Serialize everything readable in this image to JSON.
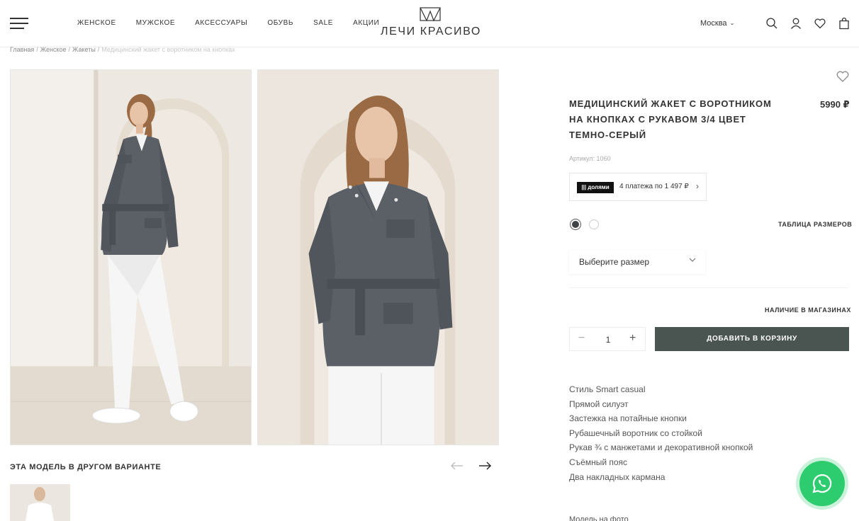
{
  "header": {
    "nav": [
      "ЖЕНСКОЕ",
      "МУЖСКОЕ",
      "АКСЕССУАРЫ",
      "ОБУВЬ",
      "SALE",
      "АКЦИИ"
    ],
    "logo_text": "ЛЕЧИ КРАСИВО",
    "city": "Москва",
    "icons": [
      "search-icon",
      "user-icon",
      "heart-icon",
      "bag-icon"
    ]
  },
  "breadcrumb": {
    "items": [
      "Главная",
      "Женское",
      "Жакеты"
    ],
    "current": "Медицинский жакет с воротником на кнопках"
  },
  "product": {
    "title": "МЕДИЦИНСКИЙ ЖАКЕТ С ВОРОТНИКОМ НА КНОПКАХ С РУКАВОМ 3/4 ЦВЕТ ТЕМНО-СЕРЫЙ",
    "price": "5990 ₽",
    "sku": "Артикул: 1060",
    "installment": {
      "badge": "||| долями",
      "text": "4 платежа по 1 497 ₽"
    },
    "colors": [
      "#3f4447",
      "#ffffff"
    ],
    "size_table": "ТАБЛИЦА РАЗМЕРОВ",
    "size_placeholder": "Выберите размер",
    "stores": "НАЛИЧИЕ В МАГАЗИНАХ",
    "quantity": "1",
    "add_to_cart": "ДОБАВИТЬ В КОРЗИНУ",
    "features": [
      "Стиль Smart casual",
      "Прямой силуэт",
      "Застежка на потайные кнопки",
      "Рубашечный воротник со стойкой",
      "Рукав ¾ с манжетами и декоративной кнопкой",
      "Съёмный пояс",
      "Два накладных кармана"
    ],
    "model_label": "Модель на фото"
  },
  "variants": {
    "title": "ЭТА МОДЕЛЬ В ДРУГОМ ВАРИАНТЕ"
  },
  "colors": {
    "accent": "#4a5551",
    "whatsapp": "#2dcc6f",
    "jacket": "#5b5f66"
  }
}
